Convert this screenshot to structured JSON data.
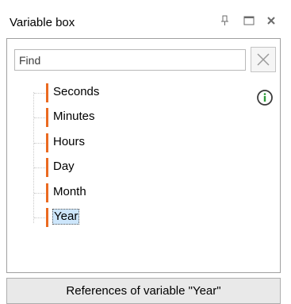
{
  "window": {
    "title": "Variable box",
    "pin_icon": "pin-icon",
    "maximize_icon": "maximize-icon",
    "close_icon": "close-icon"
  },
  "search": {
    "placeholder": "Find",
    "value": "",
    "clear_icon": "clear-x-icon"
  },
  "info_icon": "info-icon",
  "marker_color": "#ea6a21",
  "selection_color": "#cde6fb",
  "variables": [
    {
      "label": "Seconds",
      "selected": false
    },
    {
      "label": "Minutes",
      "selected": false
    },
    {
      "label": "Hours",
      "selected": false
    },
    {
      "label": "Day",
      "selected": false
    },
    {
      "label": "Month",
      "selected": false
    },
    {
      "label": "Year",
      "selected": true
    }
  ],
  "footer": {
    "references_label": "References of variable \"Year\""
  }
}
